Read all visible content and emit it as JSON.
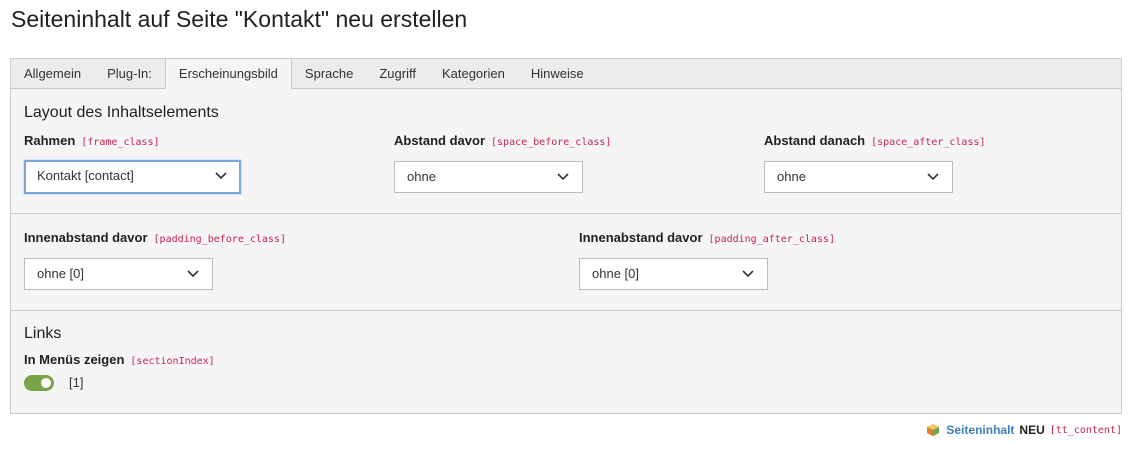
{
  "page": {
    "title": "Seiteninhalt auf Seite \"Kontakt\" neu erstellen"
  },
  "tabs": [
    {
      "label": "Allgemein",
      "active": false
    },
    {
      "label": "Plug-In:",
      "active": false
    },
    {
      "label": "Erscheinungsbild",
      "active": true
    },
    {
      "label": "Sprache",
      "active": false
    },
    {
      "label": "Zugriff",
      "active": false
    },
    {
      "label": "Kategorien",
      "active": false
    },
    {
      "label": "Hinweise",
      "active": false
    }
  ],
  "layout_section": {
    "title": "Layout des Inhaltselements",
    "frame": {
      "label": "Rahmen",
      "code": "[frame_class]",
      "value": "Kontakt [contact]"
    },
    "space_before": {
      "label": "Abstand davor",
      "code": "[space_before_class]",
      "value": "ohne"
    },
    "space_after": {
      "label": "Abstand danach",
      "code": "[space_after_class]",
      "value": "ohne"
    }
  },
  "padding_section": {
    "padding_before": {
      "label": "Innenabstand davor",
      "code": "[padding_before_class]",
      "value": "ohne [0]"
    },
    "padding_after": {
      "label": "Innenabstand davor",
      "code": "[padding_after_class]",
      "value": "ohne [0]"
    }
  },
  "links_section": {
    "title": "Links",
    "menu_index": {
      "label": "In Menüs zeigen",
      "code": "[sectionIndex]",
      "enabled": true,
      "value": "[1]"
    }
  },
  "footer": {
    "table_name": "Seiteninhalt",
    "new_flag": "NEU",
    "table_code": "[tt_content]"
  },
  "colors": {
    "accent": "#79a548",
    "link": "#3e7fbf",
    "code": "#c7254e",
    "focus": "#79a8d8"
  }
}
